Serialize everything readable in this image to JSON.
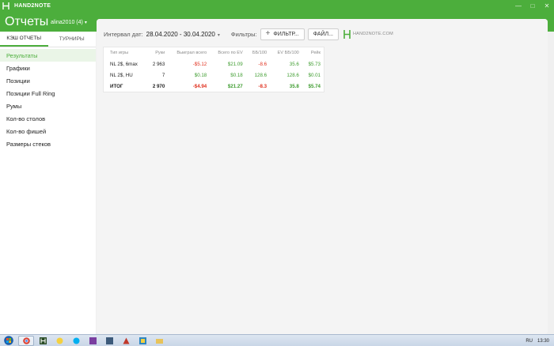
{
  "window": {
    "app_name": "HAND2NOTE",
    "controls": {
      "minimize": "—",
      "maximize": "□",
      "close": "✕"
    }
  },
  "header": {
    "title": "Отчеты",
    "user": "alina2010 (4)",
    "user_caret": "▾"
  },
  "sidebar": {
    "tabs": [
      {
        "label": "КЭШ ОТЧЕТЫ",
        "active": true
      },
      {
        "label": "ТУРНИРЫ",
        "active": false
      }
    ],
    "items": [
      {
        "label": "Результаты",
        "active": true
      },
      {
        "label": "Графики"
      },
      {
        "label": "Позиции"
      },
      {
        "label": "Позиции Full Ring"
      },
      {
        "label": "Румы"
      },
      {
        "label": "Кол-во столов"
      },
      {
        "label": "Кол-во фишей"
      },
      {
        "label": "Размеры стеков"
      }
    ]
  },
  "toolbar": {
    "interval_label": "Интервал дат:",
    "dates": "28.04.2020 - 30.04.2020",
    "dates_caret": "▾",
    "filters_label": "Фильтры:",
    "filter_button": "ФИЛЬТР...",
    "file_button": "ФАЙЛ...",
    "brand": "HAND2NOTE.COM"
  },
  "table": {
    "columns": [
      "Тип игры",
      "Руки",
      "Выиграл всего",
      "Всего по EV",
      "ББ/100",
      "EV ББ/100",
      "Рейк"
    ],
    "rows": [
      [
        "NL 2$, 6max",
        "2 963",
        "-$5.12",
        "$21.09",
        "-8.6",
        "35.6",
        "$5.73"
      ],
      [
        "NL 2$, HU",
        "7",
        "$0.18",
        "$0.18",
        "128.6",
        "128.6",
        "$0.01"
      ]
    ],
    "total": [
      "ИТОГ",
      "2 970",
      "-$4.94",
      "$21.27",
      "-8.3",
      "35.8",
      "$5.74"
    ]
  },
  "taskbar": {
    "lang": "RU",
    "time": "13:30"
  },
  "colors": {
    "brand_green": "#4cae3c",
    "negative": "#e0301e",
    "positive": "#3e9c2f"
  }
}
